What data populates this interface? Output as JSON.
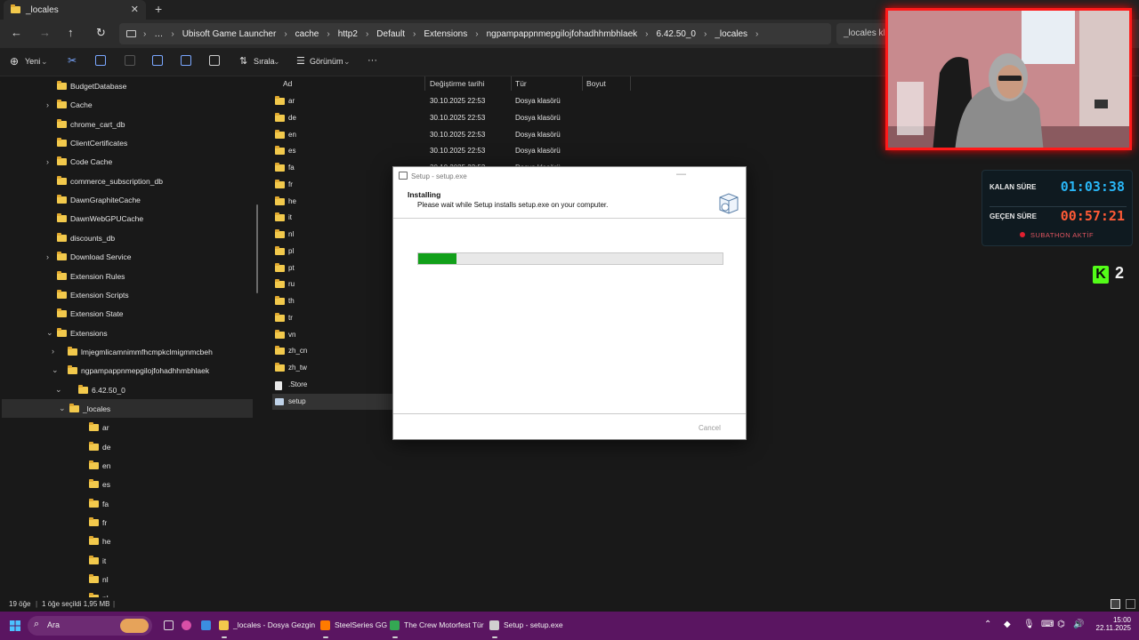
{
  "window": {
    "tab_title": "_locales",
    "tab_close": "✕",
    "new_tab": "+"
  },
  "nav": {
    "back": "←",
    "forward": "→",
    "up": "↑",
    "refresh": "↻",
    "more": "…"
  },
  "breadcrumbs": [
    "Ubisoft Game Launcher",
    "cache",
    "http2",
    "Default",
    "Extensions",
    "ngpampappnmepgilojfohadhhmbhlaek",
    "6.42.50_0",
    "_locales"
  ],
  "search_box": "_locales kla",
  "commands": {
    "new_label": "Yeni",
    "sort_label": "Sırala",
    "view_label": "Görünüm",
    "more_label": "···"
  },
  "tree": [
    {
      "label": "BudgetDatabase",
      "level": 0,
      "chevron": ""
    },
    {
      "label": "Cache",
      "level": 0,
      "chevron": "›"
    },
    {
      "label": "chrome_cart_db",
      "level": 0,
      "chevron": ""
    },
    {
      "label": "ClientCertificates",
      "level": 0,
      "chevron": ""
    },
    {
      "label": "Code Cache",
      "level": 0,
      "chevron": "›"
    },
    {
      "label": "commerce_subscription_db",
      "level": 0,
      "chevron": ""
    },
    {
      "label": "DawnGraphiteCache",
      "level": 0,
      "chevron": ""
    },
    {
      "label": "DawnWebGPUCache",
      "level": 0,
      "chevron": ""
    },
    {
      "label": "discounts_db",
      "level": 0,
      "chevron": ""
    },
    {
      "label": "Download Service",
      "level": 0,
      "chevron": "›"
    },
    {
      "label": "Extension Rules",
      "level": 0,
      "chevron": ""
    },
    {
      "label": "Extension Scripts",
      "level": 0,
      "chevron": ""
    },
    {
      "label": "Extension State",
      "level": 0,
      "chevron": ""
    },
    {
      "label": "Extensions",
      "level": 0,
      "chevron": "⌄"
    },
    {
      "label": "lmjegmlicamnimmfhcmpkclmigmmcbeh",
      "level": 1,
      "chevron": "›"
    },
    {
      "label": "ngpampappnmepgilojfohadhhmbhlaek",
      "level": 1,
      "chevron": "⌄"
    },
    {
      "label": "6.42.50_0",
      "level": 2,
      "chevron": "⌄"
    },
    {
      "label": "_locales",
      "level": 3,
      "chevron": "⌄",
      "selected": true
    },
    {
      "label": "ar",
      "level": 4,
      "chevron": ""
    },
    {
      "label": "de",
      "level": 4,
      "chevron": ""
    },
    {
      "label": "en",
      "level": 4,
      "chevron": ""
    },
    {
      "label": "es",
      "level": 4,
      "chevron": ""
    },
    {
      "label": "fa",
      "level": 4,
      "chevron": ""
    },
    {
      "label": "fr",
      "level": 4,
      "chevron": ""
    },
    {
      "label": "he",
      "level": 4,
      "chevron": ""
    },
    {
      "label": "it",
      "level": 4,
      "chevron": ""
    },
    {
      "label": "nl",
      "level": 4,
      "chevron": ""
    },
    {
      "label": "pl",
      "level": 4,
      "chevron": ""
    }
  ],
  "columns": {
    "name": "Ad",
    "date": "Değiştirme tarihi",
    "type": "Tür",
    "size": "Boyut"
  },
  "files": [
    {
      "name": "ar",
      "date": "30.10.2025 22:53",
      "type": "Dosya klasörü",
      "kind": "folder"
    },
    {
      "name": "de",
      "date": "30.10.2025 22:53",
      "type": "Dosya klasörü",
      "kind": "folder"
    },
    {
      "name": "en",
      "date": "30.10.2025 22:53",
      "type": "Dosya klasörü",
      "kind": "folder"
    },
    {
      "name": "es",
      "date": "30.10.2025 22:53",
      "type": "Dosya klasörü",
      "kind": "folder"
    },
    {
      "name": "fa",
      "date": "30.10.2025 22:53",
      "type": "Dosya klasörü",
      "kind": "folder"
    },
    {
      "name": "fr",
      "date": "",
      "type": "",
      "kind": "folder"
    },
    {
      "name": "he",
      "date": "",
      "type": "",
      "kind": "folder"
    },
    {
      "name": "it",
      "date": "",
      "type": "",
      "kind": "folder"
    },
    {
      "name": "nl",
      "date": "",
      "type": "",
      "kind": "folder"
    },
    {
      "name": "pl",
      "date": "",
      "type": "",
      "kind": "folder"
    },
    {
      "name": "pt",
      "date": "",
      "type": "",
      "kind": "folder"
    },
    {
      "name": "ru",
      "date": "",
      "type": "",
      "kind": "folder"
    },
    {
      "name": "th",
      "date": "",
      "type": "",
      "kind": "folder"
    },
    {
      "name": "tr",
      "date": "",
      "type": "",
      "kind": "folder"
    },
    {
      "name": "vn",
      "date": "",
      "type": "",
      "kind": "folder"
    },
    {
      "name": "zh_cn",
      "date": "",
      "type": "",
      "kind": "folder"
    },
    {
      "name": "zh_tw",
      "date": "",
      "type": "",
      "kind": "folder"
    },
    {
      "name": ".Store",
      "date": "",
      "type": "",
      "kind": "file"
    },
    {
      "name": "setup",
      "date": "",
      "type": "",
      "kind": "setup",
      "selected": true
    }
  ],
  "status": {
    "count": "19 öğe",
    "selection": "1 öğe seçildi  1,95 MB"
  },
  "dialog": {
    "title": "Setup - setup.exe",
    "heading": "Installing",
    "subtitle": "Please wait while Setup installs setup.exe on your computer.",
    "progress": 0.125,
    "cancel": "Cancel",
    "minimize": "—"
  },
  "timer": {
    "remaining_label": "KALAN SÜRE",
    "remaining_value": "01:03:38",
    "remaining_color": "#29b6f6",
    "elapsed_label": "GEÇEN SÜRE",
    "elapsed_value": "00:57:21",
    "elapsed_color": "#ff5a36",
    "status": "SUBATHON AKTİF"
  },
  "kick": {
    "logo": "K",
    "count": "2"
  },
  "taskbar": {
    "search": "Ara",
    "apps": [
      {
        "label": "_locales - Dosya Gezgin",
        "icon": "folder-icon",
        "color": "#f2c94c"
      },
      {
        "label": "SteelSeries GG",
        "icon": "steelseries-icon",
        "color": "#ff7a00"
      },
      {
        "label": "The Crew Motorfest Tür",
        "icon": "chrome-icon",
        "color": "#34a853"
      },
      {
        "label": "Setup - setup.exe",
        "icon": "setup-icon",
        "color": "#d0d0d0"
      }
    ],
    "time": "15:00",
    "date": "22.11.2025"
  }
}
